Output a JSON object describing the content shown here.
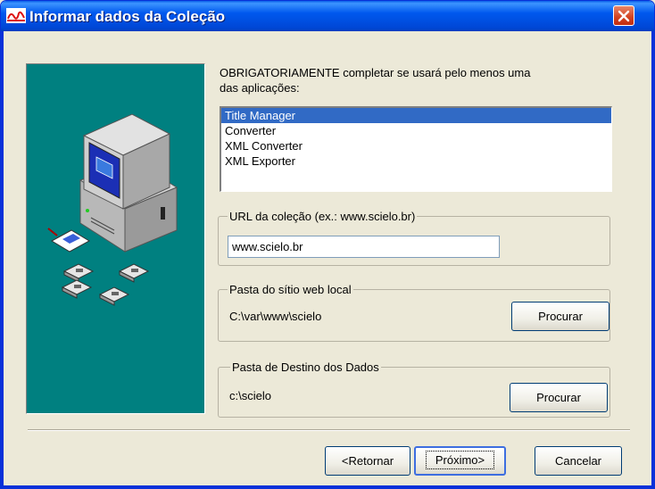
{
  "window": {
    "title": "Informar dados da Coleção",
    "app_icon": "scielo-icon",
    "close_icon": "close-icon"
  },
  "intro_text": {
    "line1": "OBRIGATORIAMENTE completar se usará pelo menos uma",
    "line2": "das aplicações:"
  },
  "applications": {
    "items": [
      "Title Manager",
      "Converter",
      "XML Converter",
      "XML Exporter"
    ],
    "selected_index": 0
  },
  "url_group": {
    "legend": "URL da coleção (ex.: www.scielo.br)",
    "value": "www.scielo.br"
  },
  "local_site_group": {
    "legend": "Pasta do sítio web local",
    "path": "C:\\var\\www\\scielo",
    "browse_label": "Procurar"
  },
  "data_dest_group": {
    "legend": "Pasta de Destino dos Dados",
    "path": "c:\\scielo",
    "browse_label": "Procurar"
  },
  "footer": {
    "back_label": "<Retornar",
    "next_label": "Próximo>",
    "cancel_label": "Cancelar"
  },
  "colors": {
    "title_bar": "#0058ee",
    "picture_background": "#008080",
    "selection": "#316ac5",
    "dialog_background": "#ece9d8"
  }
}
